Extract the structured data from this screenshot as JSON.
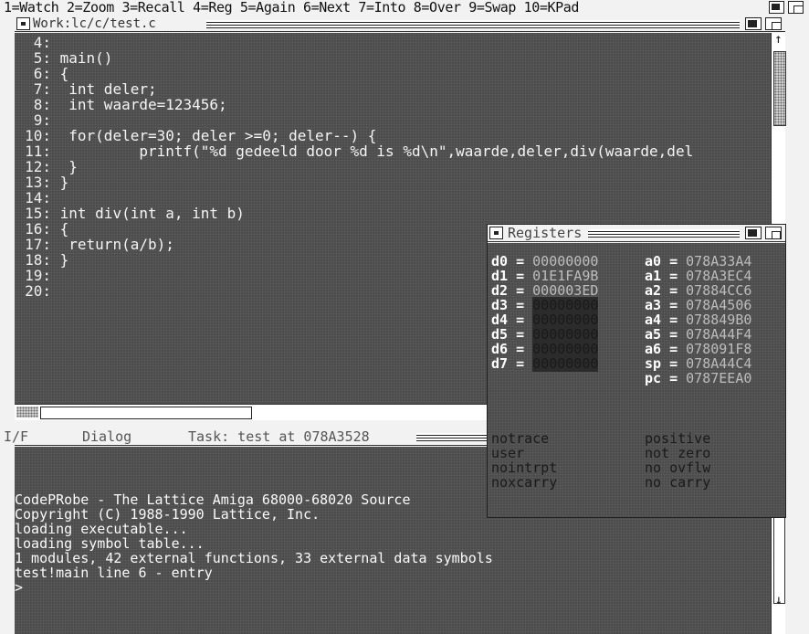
{
  "menubar": "1=Watch 2=Zoom 3=Recall 4=Reg 5=Again 6=Next 7=Into 8=Over 9=Swap 10=KPad",
  "source_window": {
    "title": "Work:lc/c/test.c",
    "lines": [
      {
        "num": "4:",
        "text": ""
      },
      {
        "num": "5:",
        "text": "main()"
      },
      {
        "num": "6:",
        "text": "{"
      },
      {
        "num": "7:",
        "text": " int deler;"
      },
      {
        "num": "8:",
        "text": " int waarde=123456;"
      },
      {
        "num": "9:",
        "text": ""
      },
      {
        "num": "10:",
        "text": " for(deler=30; deler >=0; deler--) {"
      },
      {
        "num": "11:",
        "text": "         printf(\"%d gedeeld door %d is %d\\n\",waarde,deler,div(waarde,del"
      },
      {
        "num": "12:",
        "text": " }"
      },
      {
        "num": "13:",
        "text": "}"
      },
      {
        "num": "14:",
        "text": ""
      },
      {
        "num": "15:",
        "text": "int div(int a, int b)"
      },
      {
        "num": "16:",
        "text": "{"
      },
      {
        "num": "17:",
        "text": " return(a/b);"
      },
      {
        "num": "18:",
        "text": "}"
      },
      {
        "num": "19:",
        "text": ""
      },
      {
        "num": "20:",
        "text": ""
      }
    ]
  },
  "dialog_bar": {
    "left": "I/F",
    "middle": "Dialog",
    "task": "Task: test at 078A3528"
  },
  "console": {
    "lines": [
      "CodePRobe - The Lattice Amiga 68000-68020 Source",
      "Copyright (C) 1988-1990 Lattice, Inc.",
      "loading executable...",
      "loading symbol table...",
      "1 modules, 42 external functions, 33 external data symbols",
      "test!main line 6 - entry",
      ">"
    ]
  },
  "registers": {
    "title": "Registers",
    "data": [
      {
        "name": "d0",
        "value": "00000000",
        "changed": false
      },
      {
        "name": "d1",
        "value": "01E1FA9B",
        "changed": false
      },
      {
        "name": "d2",
        "value": "000003ED",
        "changed": false
      },
      {
        "name": "d3",
        "value": "00000000",
        "changed": true
      },
      {
        "name": "d4",
        "value": "00000000",
        "changed": true
      },
      {
        "name": "d5",
        "value": "00000000",
        "changed": true
      },
      {
        "name": "d6",
        "value": "00000000",
        "changed": true
      },
      {
        "name": "d7",
        "value": "00000000",
        "changed": true
      }
    ],
    "addr": [
      {
        "name": "a0",
        "value": "078A33A4"
      },
      {
        "name": "a1",
        "value": "078A3EC4"
      },
      {
        "name": "a2",
        "value": "07884CC6"
      },
      {
        "name": "a3",
        "value": "078A4506"
      },
      {
        "name": "a4",
        "value": "078849B0"
      },
      {
        "name": "a5",
        "value": "078A44F4"
      },
      {
        "name": "a6",
        "value": "078091F8"
      },
      {
        "name": "sp",
        "value": "078A44C4"
      },
      {
        "name": "pc",
        "value": "0787EEA0"
      }
    ],
    "flags": [
      [
        "notrace",
        "positive"
      ],
      [
        "user",
        "not zero"
      ],
      [
        "nointrpt",
        "no ovflw"
      ],
      [
        "noxcarry",
        "no carry"
      ]
    ]
  }
}
